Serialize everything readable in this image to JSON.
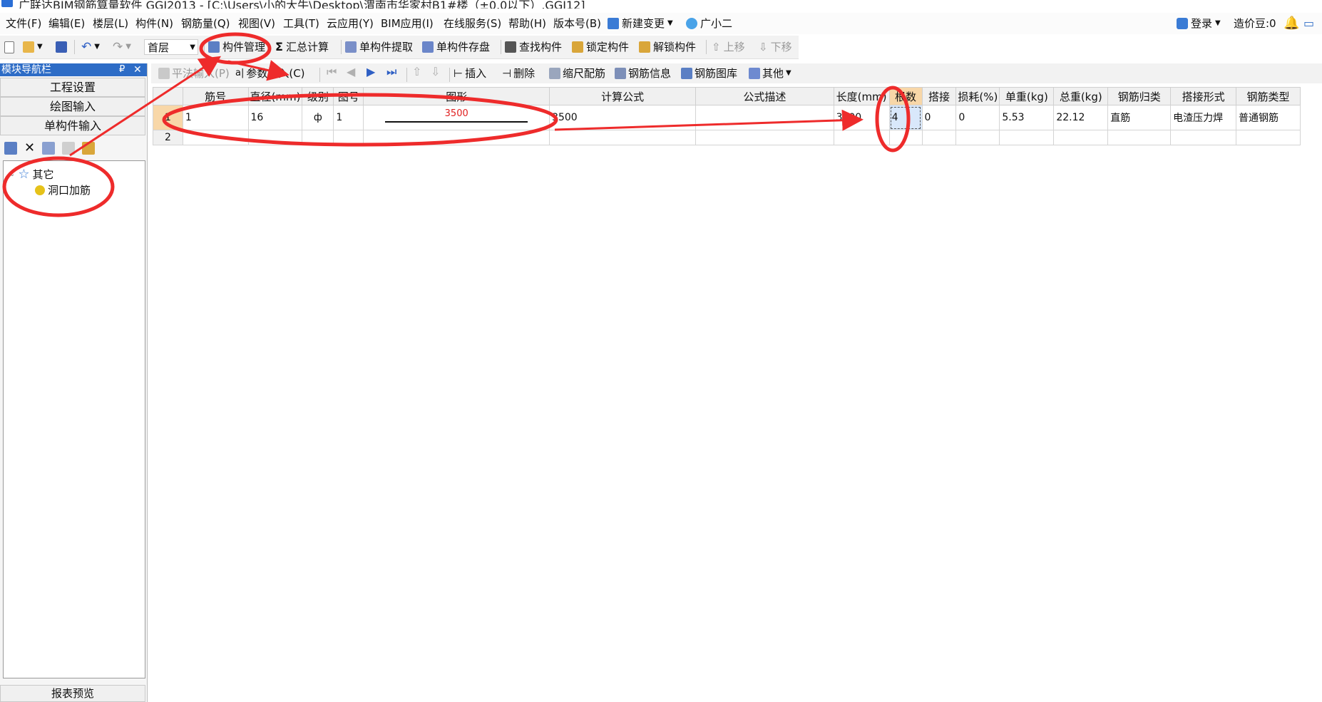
{
  "window": {
    "title": "广联达BIM钢筋算量软件 GGJ2013 - [C:\\Users\\小的大牛\\Desktop\\渭南市华家村B1#楼（±0.0以下）.GGJ12]"
  },
  "menu": {
    "items": [
      "文件(F)",
      "编辑(E)",
      "楼层(L)",
      "构件(N)",
      "钢筋量(Q)",
      "视图(V)",
      "工具(T)",
      "云应用(Y)",
      "BIM应用(I)",
      "在线服务(S)",
      "帮助(H)",
      "版本号(B)",
      "新建变更",
      "广小二"
    ],
    "login": "登录",
    "bean": "造价豆:0"
  },
  "toolbar1": {
    "floor": "首层",
    "component_manage": "构件管理",
    "summary_calc": "汇总计算",
    "single_extract": "单构件提取",
    "single_save": "单构件存盘",
    "find": "查找构件",
    "lock": "锁定构件",
    "unlock": "解锁构件",
    "move_up": "上移",
    "move_down": "下移"
  },
  "nav": {
    "title": "模块导航栏",
    "pin": "₽",
    "close": "✕",
    "sections": [
      "工程设置",
      "绘图输入",
      "单构件输入"
    ],
    "tree": {
      "root": "其它",
      "child": "洞口加筋"
    },
    "report": "报表预览"
  },
  "toolbar2": {
    "flat_input": "平法输入(P)",
    "param_input": "参数输入(C)",
    "insert": "插入",
    "delete": "删除",
    "scale_rebar": "缩尺配筋",
    "rebar_info": "钢筋信息",
    "rebar_library": "钢筋图库",
    "other": "其他"
  },
  "grid": {
    "columns": [
      "",
      "筋号",
      "直径(mm)",
      "级别",
      "图号",
      "图形",
      "计算公式",
      "公式描述",
      "长度(mm)",
      "根数",
      "搭接",
      "损耗(%)",
      "单重(kg)",
      "总重(kg)",
      "钢筋归类",
      "搭接形式",
      "钢筋类型"
    ],
    "rows": [
      {
        "num": "1",
        "bar_no": "1",
        "diameter": "16",
        "grade": "ф",
        "figure_no": "1",
        "shape_label": "3500",
        "formula": "3500",
        "formula_desc": "",
        "length": "3500",
        "count": "4",
        "lap": "0",
        "loss": "0",
        "unit_weight": "5.53",
        "total_weight": "22.12",
        "category": "直筋",
        "lap_type": "电渣压力焊",
        "rebar_type": "普通钢筋"
      },
      {
        "num": "2"
      }
    ]
  },
  "colors": {
    "nav_header": "#2d6cc6",
    "annotation": "#ee2b2b",
    "selected_header": "#f8d7a8",
    "active_cell": "#d9e8fb"
  }
}
